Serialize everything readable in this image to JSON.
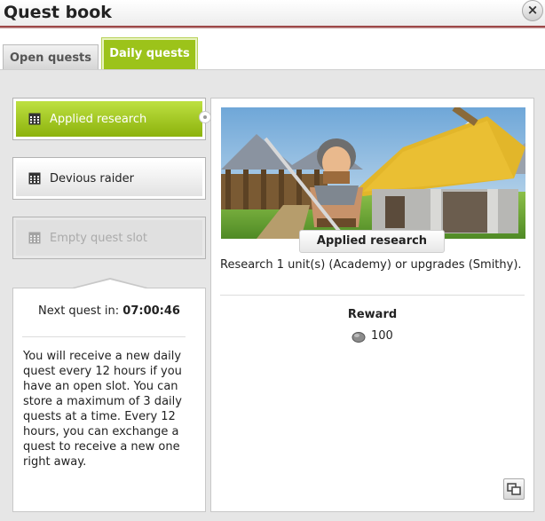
{
  "window": {
    "title": "Quest book",
    "close_label": "×"
  },
  "tabs": [
    {
      "label": "Open quests",
      "active": false
    },
    {
      "label": "Daily quests",
      "active": true
    }
  ],
  "quest_slots": [
    {
      "label": "Applied research",
      "state": "selected",
      "icon": "calendar-icon"
    },
    {
      "label": "Devious raider",
      "state": "normal",
      "icon": "calendar-icon"
    },
    {
      "label": "Empty quest slot",
      "state": "disabled",
      "icon": "calendar-icon"
    }
  ],
  "info": {
    "next_quest_label": "Next quest in:",
    "next_quest_time": "07:00:46",
    "description": "You will receive a new daily quest every 12 hours if you have an open slot. You can store a maximum of 3 daily quests at a time. Every 12 hours, you can exchange a quest to receive a new one right away."
  },
  "detail": {
    "title": "Applied research",
    "description": "Research 1 unit(s) (Academy) or upgrades (Smithy).",
    "reward_heading": "Reward",
    "reward_value": "100",
    "reward_icon": "resource-icon"
  },
  "colors": {
    "accent": "#9cc31a",
    "accent_light": "#bde041",
    "title_bar_line": "#8a1f1f"
  }
}
